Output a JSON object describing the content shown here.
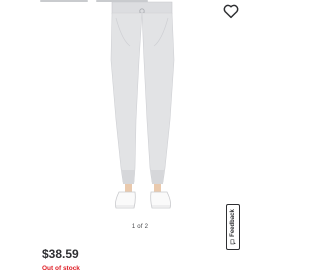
{
  "pager": {
    "text": "1 of 2"
  },
  "price": {
    "value": "$38.59"
  },
  "stock": {
    "status": "Out of stock"
  },
  "feedback": {
    "label": "Feedback"
  },
  "colors": {
    "price": "#2e2f32",
    "out_of_stock": "#de1c24",
    "pants": "#e2e3e5"
  },
  "icons": {
    "favorite": "heart-outline-icon",
    "feedback": "chat-bubble-icon"
  }
}
